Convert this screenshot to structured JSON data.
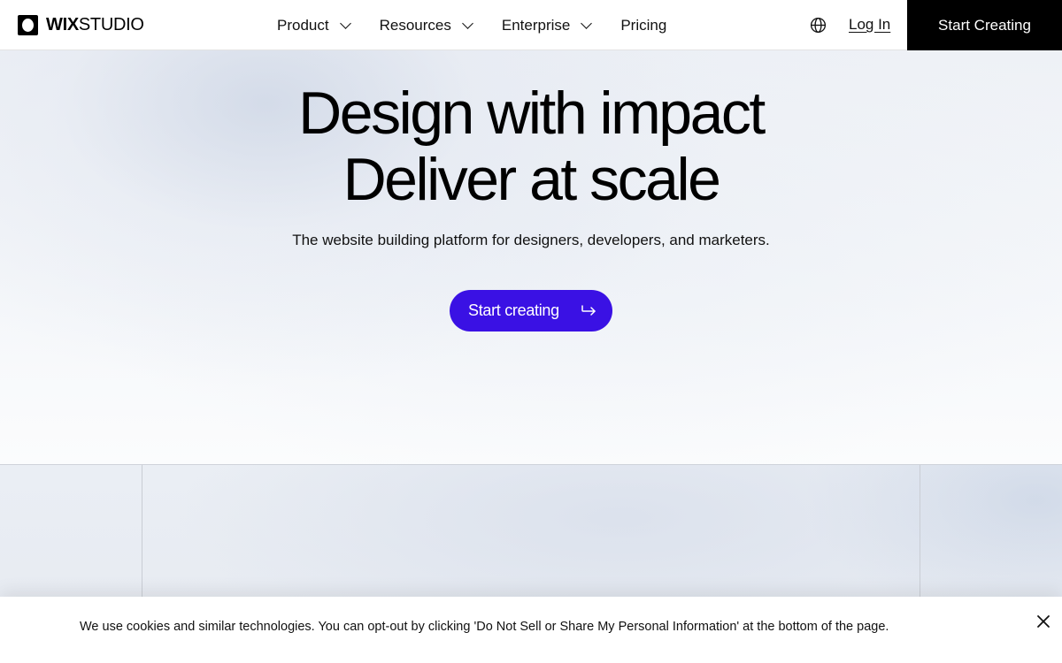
{
  "header": {
    "logo": {
      "bold": "WIX",
      "light": "STUDIO"
    },
    "nav": [
      {
        "label": "Product",
        "has_dropdown": true
      },
      {
        "label": "Resources",
        "has_dropdown": true
      },
      {
        "label": "Enterprise",
        "has_dropdown": true
      },
      {
        "label": "Pricing",
        "has_dropdown": false
      }
    ],
    "language_icon": "globe-icon",
    "login_label": "Log In",
    "cta_label": "Start Creating"
  },
  "hero": {
    "title_line1": "Design with impact",
    "title_line2": "Deliver at scale",
    "subtitle": "The website building platform for designers, developers, and marketers.",
    "cta_label": "Start creating",
    "cta_icon": "arrow-right-icon"
  },
  "cookie_banner": {
    "text": "We use cookies and similar technologies. You can opt-out by clicking 'Do Not Sell or Share My Personal Information' at the bottom of the page.",
    "close_icon": "close-icon"
  },
  "colors": {
    "primary_cta": "#3a11e4",
    "header_cta": "#000000",
    "text": "#000000"
  }
}
